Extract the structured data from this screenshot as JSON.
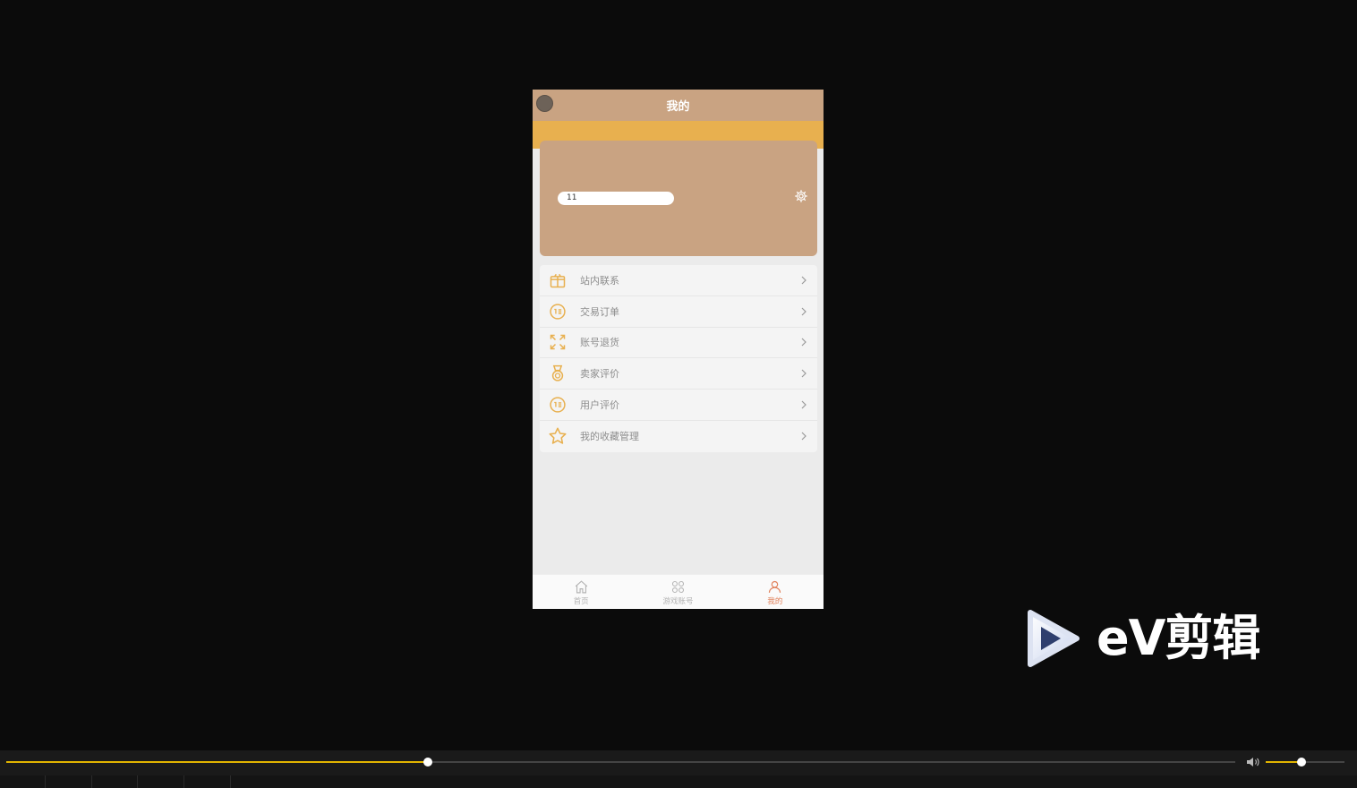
{
  "page": {
    "title": "我的",
    "user_pill_text": "11"
  },
  "menu": {
    "items": [
      {
        "label": "站内联系",
        "icon": "gift-icon"
      },
      {
        "label": "交易订单",
        "icon": "order-list-icon"
      },
      {
        "label": "账号退货",
        "icon": "expand-arrows-icon"
      },
      {
        "label": "卖家评价",
        "icon": "medal-icon"
      },
      {
        "label": "用户评价",
        "icon": "comment-list-icon"
      },
      {
        "label": "我的收藏管理",
        "icon": "star-icon"
      }
    ]
  },
  "tabbar": {
    "tabs": [
      {
        "label": "首页",
        "icon": "home-icon",
        "active": false
      },
      {
        "label": "游戏账号",
        "icon": "grid-icon",
        "active": false
      },
      {
        "label": "我的",
        "icon": "user-icon",
        "active": true
      }
    ]
  },
  "player": {
    "logo_text": "eV剪辑",
    "progress": 0.343,
    "volume": 0.45
  },
  "colors": {
    "header_bg": "#c9a382",
    "accent_gold": "#e8b04f",
    "active_tab": "#e0805a",
    "progress_fill": "#e1b400"
  }
}
